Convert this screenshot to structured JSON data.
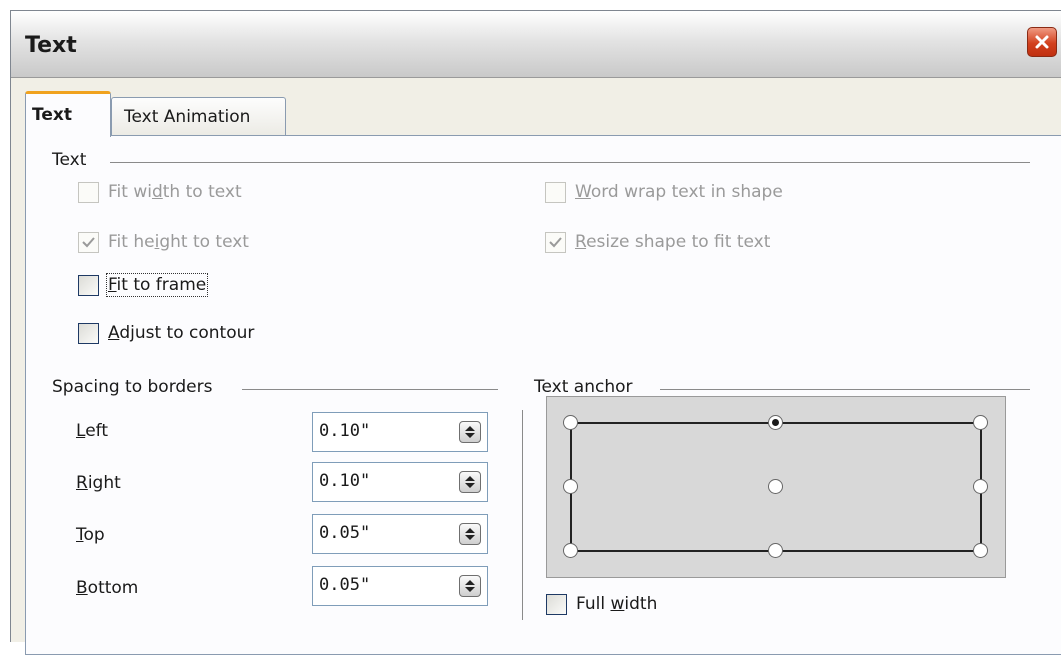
{
  "window": {
    "title": "Text",
    "close_icon": "close-icon"
  },
  "tabs": [
    {
      "label": "Text",
      "active": true
    },
    {
      "label": "Text Animation",
      "active": false
    }
  ],
  "text_section": {
    "heading": "Text",
    "fit_width": {
      "label": "Fit width to text",
      "checked": false,
      "enabled": false
    },
    "fit_height": {
      "label": "Fit height to text",
      "checked": true,
      "enabled": false
    },
    "fit_to_frame": {
      "label": "Fit to frame",
      "checked": false,
      "enabled": true
    },
    "adjust_contour": {
      "label": "Adjust to contour",
      "checked": false,
      "enabled": true
    },
    "word_wrap": {
      "label": "Word wrap text in shape",
      "checked": false,
      "enabled": false
    },
    "resize_shape": {
      "label": "Resize shape to fit text",
      "checked": true,
      "enabled": false
    }
  },
  "spacing": {
    "heading": "Spacing to borders",
    "left": {
      "label": "Left",
      "value": "0.10\""
    },
    "right": {
      "label": "Right",
      "value": "0.10\""
    },
    "top": {
      "label": "Top",
      "value": "0.05\""
    },
    "bottom": {
      "label": "Bottom",
      "value": "0.05\""
    }
  },
  "anchor": {
    "heading": "Text anchor",
    "selected": "top-center",
    "full_width": {
      "label": "Full width",
      "checked": false
    }
  },
  "colors": {
    "accent_tab": "#f0a21e",
    "close_button": "#d2411e"
  }
}
